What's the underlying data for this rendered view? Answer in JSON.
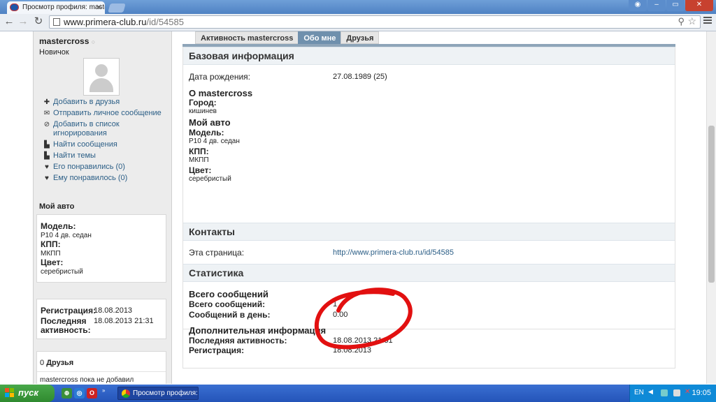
{
  "browser": {
    "tab_title": "Просмотр профиля: mastercross",
    "url_host": "www.primera-club.ru",
    "url_path": "/id/54585"
  },
  "profile": {
    "username": "mastercross",
    "online_dot": "○",
    "rank": "Новичок",
    "actions": [
      {
        "icon": "plus-icon",
        "label": "Добавить в друзья"
      },
      {
        "icon": "envelope-icon",
        "label": "Отправить личное сообщение"
      },
      {
        "icon": "block-icon",
        "label": "Добавить в список игнорирования"
      },
      {
        "icon": "messages-icon",
        "label": "Найти сообщения"
      },
      {
        "icon": "topics-icon",
        "label": "Найти темы"
      },
      {
        "icon": "heart-icon",
        "label": "Его понравились (0)"
      },
      {
        "icon": "heart-icon",
        "label": "Ему понравилось (0)"
      }
    ],
    "my_car_title": "Мой авто",
    "car": {
      "model_label": "Модель:",
      "model_value": "P10 4 дв. седан",
      "gearbox_label": "КПП:",
      "gearbox_value": "МКПП",
      "color_label": "Цвет:",
      "color_value": "серебристый"
    },
    "reg_box": {
      "reg_label": "Регистрация:",
      "reg_value": "18.08.2013",
      "last_label": "Последняя активность:",
      "last_value": "18.08.2013 21:31"
    },
    "friends_count": "0",
    "friends_title": "Друзья",
    "friends_text": "mastercross пока не добавил"
  },
  "tabs": [
    {
      "label": "Активность mastercross",
      "active": false
    },
    {
      "label": "Обо мне",
      "active": true
    },
    {
      "label": "Друзья",
      "active": false
    }
  ],
  "basic": {
    "title": "Базовая информация",
    "birth_label": "Дата рождения:",
    "birth_value": "27.08.1989 (25)",
    "about_title": "О mastercross",
    "city_label": "Город:",
    "city_value": "кишинев",
    "mycar_label": "Мой авто",
    "model_label": "Модель:",
    "model_value": "P10 4 дв. седан",
    "gearbox_label": "КПП:",
    "gearbox_value": "МКПП",
    "color_label": "Цвет:",
    "color_value": "серебристый"
  },
  "contacts": {
    "title": "Контакты",
    "page_label": "Эта страница:",
    "page_value": "http://www.primera-club.ru/id/54585"
  },
  "stats": {
    "title": "Статистика",
    "total_title": "Всего сообщений",
    "total_label": "Всего сообщений:",
    "total_value": "1",
    "perday_label": "Сообщений в день:",
    "perday_value": "0.00",
    "extra_title": "Дополнительная информация",
    "last_label": "Последняя активность:",
    "last_value": "18.08.2013 21:31",
    "reg_label": "Регистрация:",
    "reg_value": "18.08.2013"
  },
  "annotation": {
    "color": "#e21010"
  },
  "taskbar": {
    "start_label": "пуск",
    "task_title": "Просмотр профиля: ...",
    "lang": "EN",
    "clock": "19:05"
  }
}
